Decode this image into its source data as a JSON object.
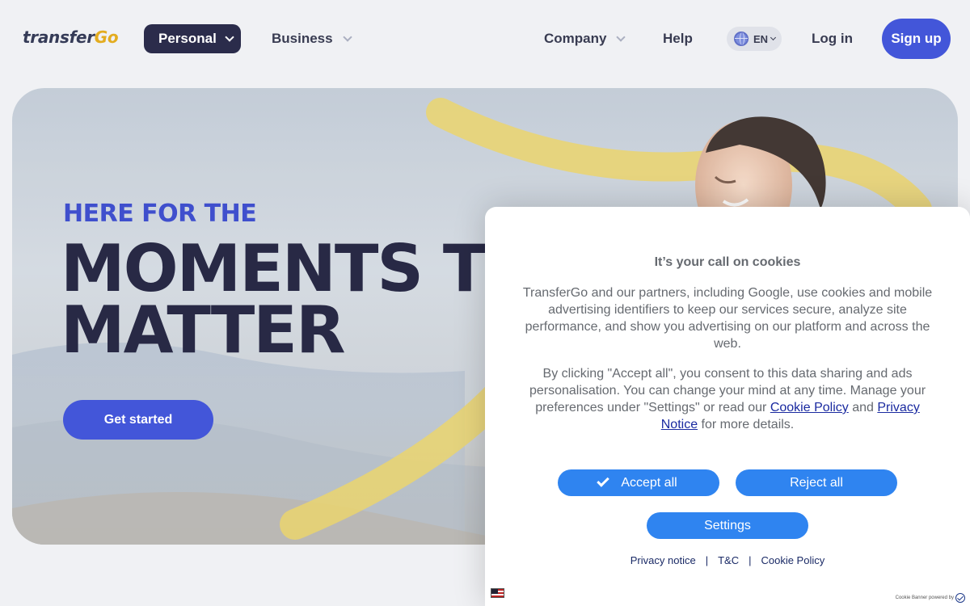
{
  "header": {
    "logo_prefix": "transfer",
    "logo_suffix": "Go",
    "nav": {
      "personal": "Personal",
      "business": "Business",
      "company": "Company",
      "help": "Help"
    },
    "language": "EN",
    "login": "Log in",
    "signup": "Sign up"
  },
  "hero": {
    "eyebrow": "HERE FOR THE",
    "headline_line1": "MOMENTS THAT",
    "headline_line2": "MATTER",
    "cta": "Get started"
  },
  "cookie_banner": {
    "title": "It’s your call on cookies",
    "paragraph1": "TransferGo and our partners, including Google, use cookies and mobile advertising identifiers to keep our services secure, analyze site performance, and show you advertising on our platform and across the web.",
    "paragraph2_prefix": "By clicking \"Accept all\", you consent to this data sharing and ads personalisation. You can change your mind at any time. Manage your preferences under \"Settings\" or read our ",
    "cookie_policy_link": "Cookie Policy",
    "paragraph2_and": " and ",
    "privacy_notice_link": "Privacy Notice",
    "paragraph2_suffix": " for more details.",
    "accept_all": "Accept all",
    "reject_all": "Reject all",
    "settings": "Settings",
    "footer": {
      "privacy_notice": "Privacy notice",
      "tc": "T&C",
      "cookie_policy": "Cookie Policy",
      "separator": "|"
    },
    "powered_by": "Cookie Banner powered by"
  },
  "colors": {
    "brand_blue": "#2a3fd4",
    "navy": "#0e0f33",
    "cookie_button": "#2f84f0",
    "logo_accent": "#e0a100"
  }
}
